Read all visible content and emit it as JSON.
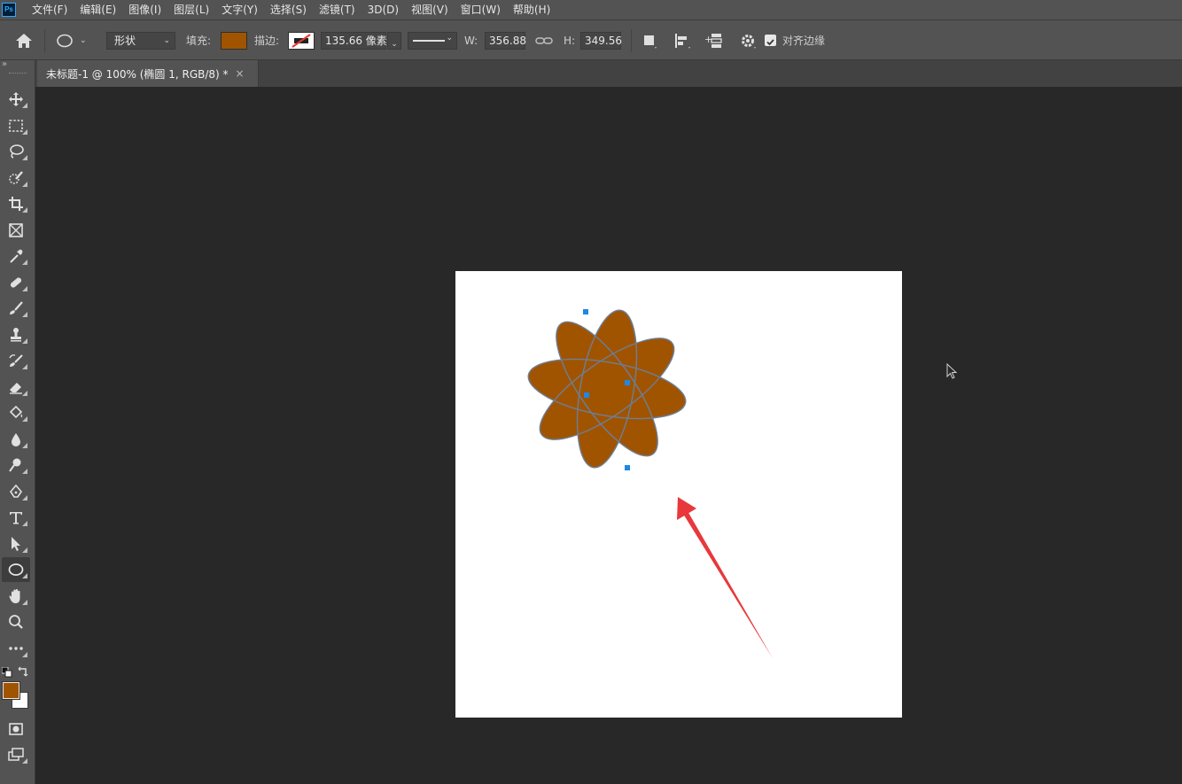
{
  "app": {
    "logo_text": "Ps"
  },
  "menu": [
    "文件(F)",
    "编辑(E)",
    "图像(I)",
    "图层(L)",
    "文字(Y)",
    "选择(S)",
    "滤镜(T)",
    "3D(D)",
    "视图(V)",
    "窗口(W)",
    "帮助(H)"
  ],
  "options": {
    "mode_value": "形状",
    "fill_label": "填充:",
    "fill_color": "#a15400",
    "stroke_label": "描边:",
    "stroke_width_value": "135.66 像素",
    "w_label": "W:",
    "w_value": "356.88",
    "h_label": "H:",
    "h_value": "349.56",
    "align_edges_label": "对齐边缘",
    "align_edges_checked": true
  },
  "document": {
    "tab_title": "未标题-1 @ 100% (椭圆 1, RGB/8) *",
    "close_glyph": "×"
  },
  "colors": {
    "foreground": "#a15400",
    "background": "#ffffff",
    "shape_fill": "#a15400",
    "shape_stroke": "#6b7f9a",
    "anchor": "#1e88e5",
    "arrow": "#e8383b"
  },
  "tools": [
    {
      "name": "move-tool",
      "icon": "move-icon"
    },
    {
      "name": "marquee-tool",
      "icon": "rect-marquee-icon"
    },
    {
      "name": "lasso-tool",
      "icon": "lasso-icon"
    },
    {
      "name": "quick-select-tool",
      "icon": "quick-select-icon"
    },
    {
      "name": "crop-tool",
      "icon": "crop-icon"
    },
    {
      "name": "frame-tool",
      "icon": "frame-icon"
    },
    {
      "name": "eyedropper-tool",
      "icon": "eyedropper-icon"
    },
    {
      "name": "healing-tool",
      "icon": "bandage-icon"
    },
    {
      "name": "brush-tool",
      "icon": "brush-icon"
    },
    {
      "name": "stamp-tool",
      "icon": "stamp-icon"
    },
    {
      "name": "history-brush-tool",
      "icon": "history-brush-icon"
    },
    {
      "name": "eraser-tool",
      "icon": "eraser-icon"
    },
    {
      "name": "paint-bucket-tool",
      "icon": "bucket-icon"
    },
    {
      "name": "blur-tool",
      "icon": "drop-icon"
    },
    {
      "name": "dodge-tool",
      "icon": "dodge-icon"
    },
    {
      "name": "pen-tool",
      "icon": "pen-icon"
    },
    {
      "name": "type-tool",
      "icon": "type-icon"
    },
    {
      "name": "path-select-tool",
      "icon": "arrow-select-icon"
    },
    {
      "name": "ellipse-tool",
      "icon": "ellipse-icon",
      "active": true
    },
    {
      "name": "hand-tool",
      "icon": "hand-icon"
    },
    {
      "name": "zoom-tool",
      "icon": "zoom-icon"
    },
    {
      "name": "more-tools",
      "icon": "ellipsis-icon"
    }
  ]
}
